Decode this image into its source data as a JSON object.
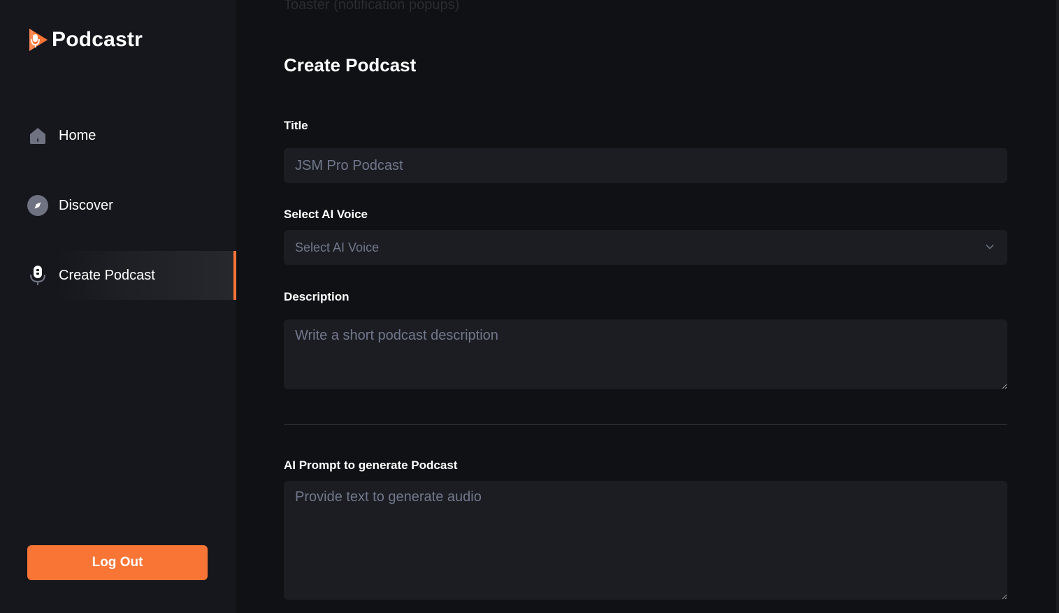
{
  "app": {
    "name": "Podcastr",
    "accent_color": "#f97535"
  },
  "sidebar": {
    "items": [
      {
        "label": "Home",
        "icon": "home-icon",
        "active": false
      },
      {
        "label": "Discover",
        "icon": "compass-icon",
        "active": false
      },
      {
        "label": "Create Podcast",
        "icon": "microphone-icon",
        "active": true
      }
    ],
    "logout_label": "Log Out"
  },
  "toaster_text": "Toaster (notification popups)",
  "form": {
    "title": "Create Podcast",
    "title_field": {
      "label": "Title",
      "placeholder": "JSM Pro Podcast",
      "value": ""
    },
    "voice_field": {
      "label": "Select AI Voice",
      "selected": "Select AI Voice"
    },
    "description_field": {
      "label": "Description",
      "placeholder": "Write a short podcast description",
      "value": ""
    },
    "prompt_field": {
      "label": "AI Prompt to generate Podcast",
      "placeholder": "Provide text to generate audio",
      "value": ""
    }
  }
}
